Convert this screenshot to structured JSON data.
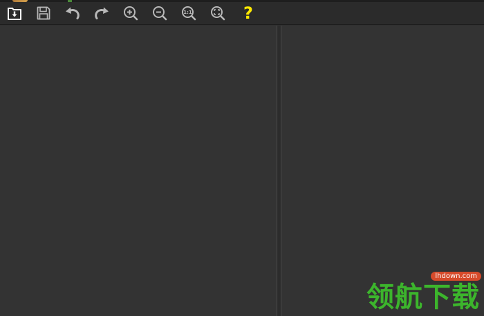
{
  "colors": {
    "icon": "#b8b8b8",
    "icon_primary": "#ffffff",
    "help": "#ffe900",
    "watermark_green": "#3cb52c",
    "watermark_badge": "#d64a2a"
  },
  "toolbar": {
    "tools": [
      {
        "id": "open",
        "icon": "open-folder-icon"
      },
      {
        "id": "save",
        "icon": "save-icon"
      },
      {
        "id": "undo",
        "icon": "undo-icon"
      },
      {
        "id": "redo",
        "icon": "redo-icon"
      },
      {
        "id": "zoom-in",
        "icon": "zoom-in-icon"
      },
      {
        "id": "zoom-out",
        "icon": "zoom-out-icon"
      },
      {
        "id": "actual-size",
        "icon": "actual-size-icon",
        "label": "1:1"
      },
      {
        "id": "fit-window",
        "icon": "fit-window-icon"
      },
      {
        "id": "help",
        "icon": "help-icon",
        "label": "?"
      }
    ]
  },
  "watermark": {
    "url": "lhdown.com",
    "text": "领航下载"
  }
}
